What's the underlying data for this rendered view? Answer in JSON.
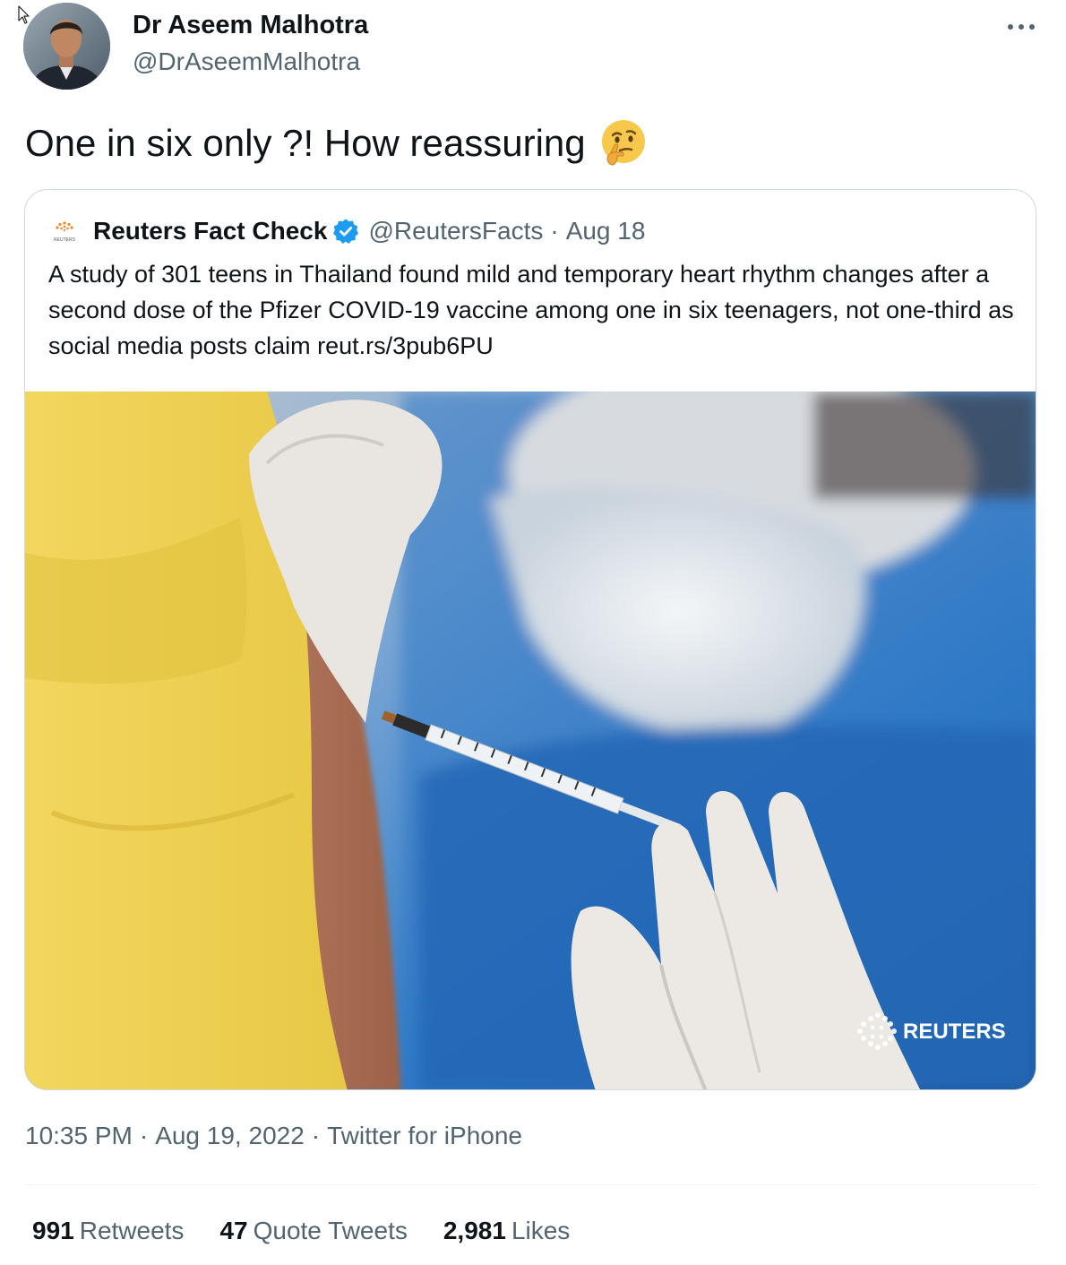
{
  "author": {
    "name": "Dr Aseem Malhotra",
    "handle": "@DrAseemMalhotra",
    "more_icon": "more-horizontal-icon"
  },
  "tweet": {
    "text": "One in six only ?! How reassuring",
    "emoji": "thinking-face"
  },
  "quote": {
    "name": "Reuters Fact Check",
    "verified": true,
    "handle": "@ReutersFacts",
    "separator": "·",
    "date": "Aug 18",
    "text": "A study of 301 teens in Thailand found mild and temporary heart rhythm changes after a second dose of the Pfizer COVID-19 vaccine among one in six teenagers, not one-third as social media posts claim reut.rs/3pub6PU",
    "logo_label": "REUTERS",
    "image_watermark": "REUTERS"
  },
  "meta": {
    "time": "10:35 PM",
    "dot1": "·",
    "date": "Aug 19, 2022",
    "dot2": "·",
    "source": "Twitter for iPhone"
  },
  "stats": {
    "retweets_count": "991",
    "retweets_label": "Retweets",
    "quotes_count": "47",
    "quotes_label": "Quote Tweets",
    "likes_count": "2,981",
    "likes_label": "Likes"
  },
  "colors": {
    "text": "#0f1419",
    "secondary": "#536471",
    "border": "#cfd9de",
    "verified": "#1d9bf0"
  }
}
